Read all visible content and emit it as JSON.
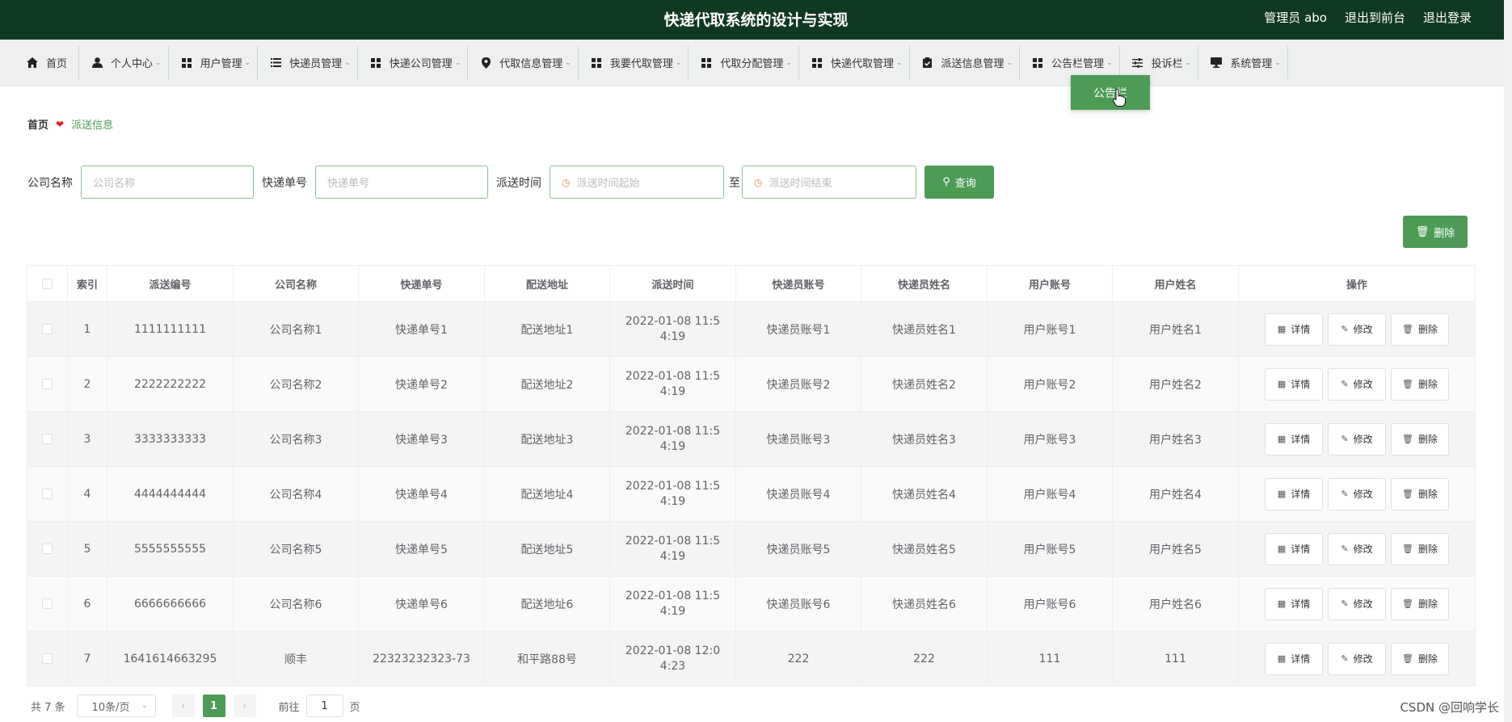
{
  "header": {
    "title": "快递代取系统的设计与实现",
    "user": "管理员 abo",
    "back_to_front": "退出到前台",
    "logout": "退出登录"
  },
  "nav": [
    {
      "label": "首页",
      "icon": "home-icon",
      "has_dropdown": false
    },
    {
      "label": "个人中心",
      "icon": "person-icon",
      "has_dropdown": true
    },
    {
      "label": "用户管理",
      "icon": "grid-icon",
      "has_dropdown": true
    },
    {
      "label": "快递员管理",
      "icon": "list-icon",
      "has_dropdown": true
    },
    {
      "label": "快递公司管理",
      "icon": "grid-icon",
      "has_dropdown": true
    },
    {
      "label": "代取信息管理",
      "icon": "pin-icon",
      "has_dropdown": true
    },
    {
      "label": "我要代取管理",
      "icon": "grid-icon",
      "has_dropdown": true
    },
    {
      "label": "代取分配管理",
      "icon": "grid-icon",
      "has_dropdown": true
    },
    {
      "label": "快递代取管理",
      "icon": "grid-icon",
      "has_dropdown": true
    },
    {
      "label": "派送信息管理",
      "icon": "clipboard-icon",
      "has_dropdown": true
    },
    {
      "label": "公告栏管理",
      "icon": "grid-icon",
      "has_dropdown": true
    },
    {
      "label": "投诉栏",
      "icon": "sliders-icon",
      "has_dropdown": true
    },
    {
      "label": "系统管理",
      "icon": "monitor-icon",
      "has_dropdown": true
    }
  ],
  "dropdown": {
    "item": "公告栏"
  },
  "breadcrumb": {
    "home": "首页",
    "current": "派送信息"
  },
  "search": {
    "company_label": "公司名称",
    "company_placeholder": "公司名称",
    "tracking_label": "快递单号",
    "tracking_placeholder": "快递单号",
    "time_label": "派送时间",
    "time_start_placeholder": "派送时间起始",
    "time_sep": "至",
    "time_end_placeholder": "派送时间结束",
    "query_button": "查询"
  },
  "delete_all_button": "删除",
  "table": {
    "headers": [
      "索引",
      "派送编号",
      "公司名称",
      "快递单号",
      "配送地址",
      "派送时间",
      "快递员账号",
      "快递员姓名",
      "用户账号",
      "用户姓名",
      "操作"
    ],
    "rows": [
      {
        "index": "1",
        "no": "1111111111",
        "company": "公司名称1",
        "tracking": "快递单号1",
        "address": "配送地址1",
        "time": "2022-01-08 11:54:19",
        "courier_account": "快递员账号1",
        "courier_name": "快递员姓名1",
        "user_account": "用户账号1",
        "user_name": "用户姓名1"
      },
      {
        "index": "2",
        "no": "2222222222",
        "company": "公司名称2",
        "tracking": "快递单号2",
        "address": "配送地址2",
        "time": "2022-01-08 11:54:19",
        "courier_account": "快递员账号2",
        "courier_name": "快递员姓名2",
        "user_account": "用户账号2",
        "user_name": "用户姓名2"
      },
      {
        "index": "3",
        "no": "3333333333",
        "company": "公司名称3",
        "tracking": "快递单号3",
        "address": "配送地址3",
        "time": "2022-01-08 11:54:19",
        "courier_account": "快递员账号3",
        "courier_name": "快递员姓名3",
        "user_account": "用户账号3",
        "user_name": "用户姓名3"
      },
      {
        "index": "4",
        "no": "4444444444",
        "company": "公司名称4",
        "tracking": "快递单号4",
        "address": "配送地址4",
        "time": "2022-01-08 11:54:19",
        "courier_account": "快递员账号4",
        "courier_name": "快递员姓名4",
        "user_account": "用户账号4",
        "user_name": "用户姓名4"
      },
      {
        "index": "5",
        "no": "5555555555",
        "company": "公司名称5",
        "tracking": "快递单号5",
        "address": "配送地址5",
        "time": "2022-01-08 11:54:19",
        "courier_account": "快递员账号5",
        "courier_name": "快递员姓名5",
        "user_account": "用户账号5",
        "user_name": "用户姓名5"
      },
      {
        "index": "6",
        "no": "6666666666",
        "company": "公司名称6",
        "tracking": "快递单号6",
        "address": "配送地址6",
        "time": "2022-01-08 11:54:19",
        "courier_account": "快递员账号6",
        "courier_name": "快递员姓名6",
        "user_account": "用户账号6",
        "user_name": "用户姓名6"
      },
      {
        "index": "7",
        "no": "1641614663295",
        "company": "顺丰",
        "tracking": "22323232323-73",
        "address": "和平路88号",
        "time": "2022-01-08 12:04:23",
        "courier_account": "222",
        "courier_name": "222",
        "user_account": "111",
        "user_name": "111"
      }
    ],
    "actions": {
      "detail": "详情",
      "edit": "修改",
      "delete": "删除"
    }
  },
  "pagination": {
    "total": "共 7 条",
    "page_size": "10条/页",
    "current_page": "1",
    "goto_label": "前往",
    "goto_value": "1",
    "page_unit": "页"
  },
  "watermark": "CSDN @回响学长",
  "colors": {
    "header_bg": "#0f3a21",
    "accent": "#4d9b55",
    "nav_bg": "#eef0f0"
  }
}
